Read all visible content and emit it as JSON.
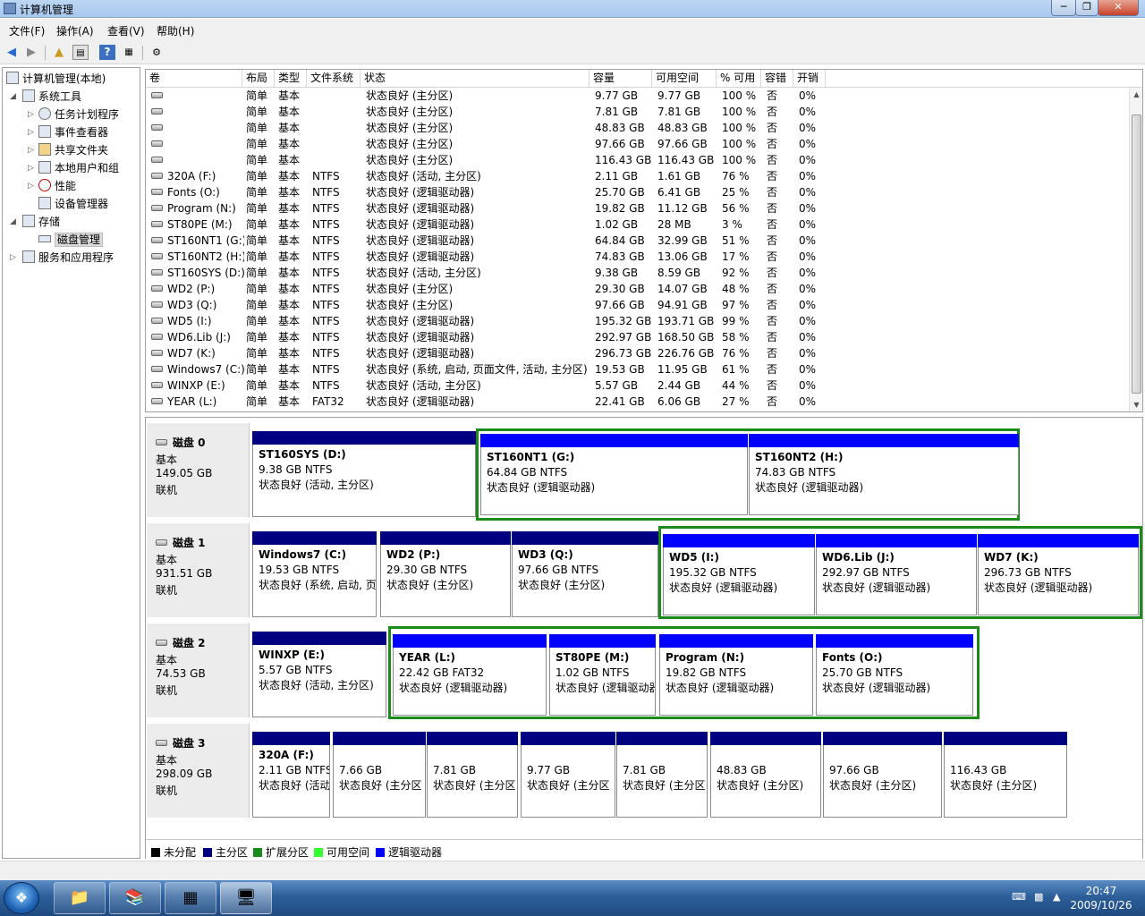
{
  "window": {
    "title": "计算机管理"
  },
  "menu": [
    "文件(F)",
    "操作(A)",
    "查看(V)",
    "帮助(H)"
  ],
  "tree": {
    "root": "计算机管理(本地)",
    "system_tools": "系统工具",
    "task_scheduler": "任务计划程序",
    "event_viewer": "事件查看器",
    "shared_folders": "共享文件夹",
    "local_users": "本地用户和组",
    "performance": "性能",
    "device_manager": "设备管理器",
    "storage": "存储",
    "disk_management": "磁盘管理",
    "services": "服务和应用程序"
  },
  "columns": [
    "卷",
    "布局",
    "类型",
    "文件系统",
    "状态",
    "容量",
    "可用空间",
    "% 可用",
    "容错",
    "开销"
  ],
  "volumes": [
    [
      "",
      "简单",
      "基本",
      "",
      "状态良好 (主分区)",
      "9.77 GB",
      "9.77 GB",
      "100 %",
      "否",
      "0%"
    ],
    [
      "",
      "简单",
      "基本",
      "",
      "状态良好 (主分区)",
      "7.81 GB",
      "7.81 GB",
      "100 %",
      "否",
      "0%"
    ],
    [
      "",
      "简单",
      "基本",
      "",
      "状态良好 (主分区)",
      "48.83 GB",
      "48.83 GB",
      "100 %",
      "否",
      "0%"
    ],
    [
      "",
      "简单",
      "基本",
      "",
      "状态良好 (主分区)",
      "97.66 GB",
      "97.66 GB",
      "100 %",
      "否",
      "0%"
    ],
    [
      "",
      "简单",
      "基本",
      "",
      "状态良好 (主分区)",
      "116.43 GB",
      "116.43 GB",
      "100 %",
      "否",
      "0%"
    ],
    [
      "320A (F:)",
      "简单",
      "基本",
      "NTFS",
      "状态良好 (活动, 主分区)",
      "2.11 GB",
      "1.61 GB",
      "76 %",
      "否",
      "0%"
    ],
    [
      "Fonts (O:)",
      "简单",
      "基本",
      "NTFS",
      "状态良好 (逻辑驱动器)",
      "25.70 GB",
      "6.41 GB",
      "25 %",
      "否",
      "0%"
    ],
    [
      "Program (N:)",
      "简单",
      "基本",
      "NTFS",
      "状态良好 (逻辑驱动器)",
      "19.82 GB",
      "11.12 GB",
      "56 %",
      "否",
      "0%"
    ],
    [
      "ST80PE (M:)",
      "简单",
      "基本",
      "NTFS",
      "状态良好 (逻辑驱动器)",
      "1.02 GB",
      "28 MB",
      "3 %",
      "否",
      "0%"
    ],
    [
      "ST160NT1 (G:)",
      "简单",
      "基本",
      "NTFS",
      "状态良好 (逻辑驱动器)",
      "64.84 GB",
      "32.99 GB",
      "51 %",
      "否",
      "0%"
    ],
    [
      "ST160NT2 (H:)",
      "简单",
      "基本",
      "NTFS",
      "状态良好 (逻辑驱动器)",
      "74.83 GB",
      "13.06 GB",
      "17 %",
      "否",
      "0%"
    ],
    [
      "ST160SYS (D:)",
      "简单",
      "基本",
      "NTFS",
      "状态良好 (活动, 主分区)",
      "9.38 GB",
      "8.59 GB",
      "92 %",
      "否",
      "0%"
    ],
    [
      "WD2 (P:)",
      "简单",
      "基本",
      "NTFS",
      "状态良好 (主分区)",
      "29.30 GB",
      "14.07 GB",
      "48 %",
      "否",
      "0%"
    ],
    [
      "WD3 (Q:)",
      "简单",
      "基本",
      "NTFS",
      "状态良好 (主分区)",
      "97.66 GB",
      "94.91 GB",
      "97 %",
      "否",
      "0%"
    ],
    [
      "WD5 (I:)",
      "简单",
      "基本",
      "NTFS",
      "状态良好 (逻辑驱动器)",
      "195.32 GB",
      "193.71 GB",
      "99 %",
      "否",
      "0%"
    ],
    [
      "WD6.Lib (J:)",
      "简单",
      "基本",
      "NTFS",
      "状态良好 (逻辑驱动器)",
      "292.97 GB",
      "168.50 GB",
      "58 %",
      "否",
      "0%"
    ],
    [
      "WD7 (K:)",
      "简单",
      "基本",
      "NTFS",
      "状态良好 (逻辑驱动器)",
      "296.73 GB",
      "226.76 GB",
      "76 %",
      "否",
      "0%"
    ],
    [
      "Windows7 (C:)",
      "简单",
      "基本",
      "NTFS",
      "状态良好 (系统, 启动, 页面文件, 活动, 主分区)",
      "19.53 GB",
      "11.95 GB",
      "61 %",
      "否",
      "0%"
    ],
    [
      "WINXP (E:)",
      "简单",
      "基本",
      "NTFS",
      "状态良好 (活动, 主分区)",
      "5.57 GB",
      "2.44 GB",
      "44 %",
      "否",
      "0%"
    ],
    [
      "YEAR (L:)",
      "简单",
      "基本",
      "FAT32",
      "状态良好 (逻辑驱动器)",
      "22.41 GB",
      "6.06 GB",
      "27 %",
      "否",
      "0%"
    ]
  ],
  "disks": [
    {
      "name": "磁盘 0",
      "type": "基本",
      "size": "149.05 GB",
      "status": "联机",
      "partitions": [
        {
          "name": "ST160SYS  (D:)",
          "size": "9.38 GB NTFS",
          "status": "状态良好 (活动, 主分区)",
          "kind": "primary"
        },
        {
          "name": "ST160NT1  (G:)",
          "size": "64.84 GB NTFS",
          "status": "状态良好 (逻辑驱动器)",
          "kind": "logical"
        },
        {
          "name": "ST160NT2  (H:)",
          "size": "74.83 GB NTFS",
          "status": "状态良好 (逻辑驱动器)",
          "kind": "logical"
        }
      ]
    },
    {
      "name": "磁盘 1",
      "type": "基本",
      "size": "931.51 GB",
      "status": "联机",
      "partitions": [
        {
          "name": "Windows7  (C:)",
          "size": "19.53 GB NTFS",
          "status": "状态良好 (系统, 启动, 页",
          "kind": "primary"
        },
        {
          "name": "WD2  (P:)",
          "size": "29.30 GB NTFS",
          "status": "状态良好 (主分区)",
          "kind": "primary"
        },
        {
          "name": "WD3  (Q:)",
          "size": "97.66 GB NTFS",
          "status": "状态良好 (主分区)",
          "kind": "primary"
        },
        {
          "name": "WD5  (I:)",
          "size": "195.32 GB NTFS",
          "status": "状态良好 (逻辑驱动器)",
          "kind": "logical"
        },
        {
          "name": "WD6.Lib  (J:)",
          "size": "292.97 GB NTFS",
          "status": "状态良好 (逻辑驱动器)",
          "kind": "logical"
        },
        {
          "name": "WD7  (K:)",
          "size": "296.73 GB NTFS",
          "status": "状态良好 (逻辑驱动器)",
          "kind": "logical"
        }
      ]
    },
    {
      "name": "磁盘 2",
      "type": "基本",
      "size": "74.53 GB",
      "status": "联机",
      "partitions": [
        {
          "name": "WINXP  (E:)",
          "size": "5.57 GB NTFS",
          "status": "状态良好 (活动, 主分区)",
          "kind": "primary"
        },
        {
          "name": "YEAR  (L:)",
          "size": "22.42 GB FAT32",
          "status": "状态良好 (逻辑驱动器)",
          "kind": "logical"
        },
        {
          "name": "ST80PE  (M:)",
          "size": "1.02 GB NTFS",
          "status": "状态良好 (逻辑驱动器",
          "kind": "logical"
        },
        {
          "name": "Program  (N:)",
          "size": "19.82 GB NTFS",
          "status": "状态良好 (逻辑驱动器)",
          "kind": "logical"
        },
        {
          "name": "Fonts  (O:)",
          "size": "25.70 GB NTFS",
          "status": "状态良好 (逻辑驱动器)",
          "kind": "logical"
        }
      ]
    },
    {
      "name": "磁盘 3",
      "type": "基本",
      "size": "298.09 GB",
      "status": "联机",
      "partitions": [
        {
          "name": "320A  (F:)",
          "size": "2.11 GB NTFS",
          "status": "状态良好 (活动",
          "kind": "primary"
        },
        {
          "name": "",
          "size": "7.66 GB",
          "status": "状态良好 (主分区",
          "kind": "primary"
        },
        {
          "name": "",
          "size": "7.81 GB",
          "status": "状态良好 (主分区",
          "kind": "primary"
        },
        {
          "name": "",
          "size": "9.77 GB",
          "status": "状态良好 (主分区",
          "kind": "primary"
        },
        {
          "name": "",
          "size": "7.81 GB",
          "status": "状态良好 (主分区",
          "kind": "primary"
        },
        {
          "name": "",
          "size": "48.83 GB",
          "status": "状态良好 (主分区)",
          "kind": "primary"
        },
        {
          "name": "",
          "size": "97.66 GB",
          "status": "状态良好 (主分区)",
          "kind": "primary"
        },
        {
          "name": "",
          "size": "116.43 GB",
          "status": "状态良好 (主分区)",
          "kind": "primary"
        }
      ]
    }
  ],
  "legend": [
    {
      "label": "未分配",
      "color": "#000000"
    },
    {
      "label": "主分区",
      "color": "#000080"
    },
    {
      "label": "扩展分区",
      "color": "#1a8a1a"
    },
    {
      "label": "可用空间",
      "color": "#33ff33"
    },
    {
      "label": "逻辑驱动器",
      "color": "#0000ff"
    }
  ],
  "colors": {
    "primary": "#000080",
    "logical": "#0000ff",
    "extended": "#1a8a1a"
  },
  "taskbar": {
    "time": "20:47",
    "date": "2009/10/26"
  }
}
